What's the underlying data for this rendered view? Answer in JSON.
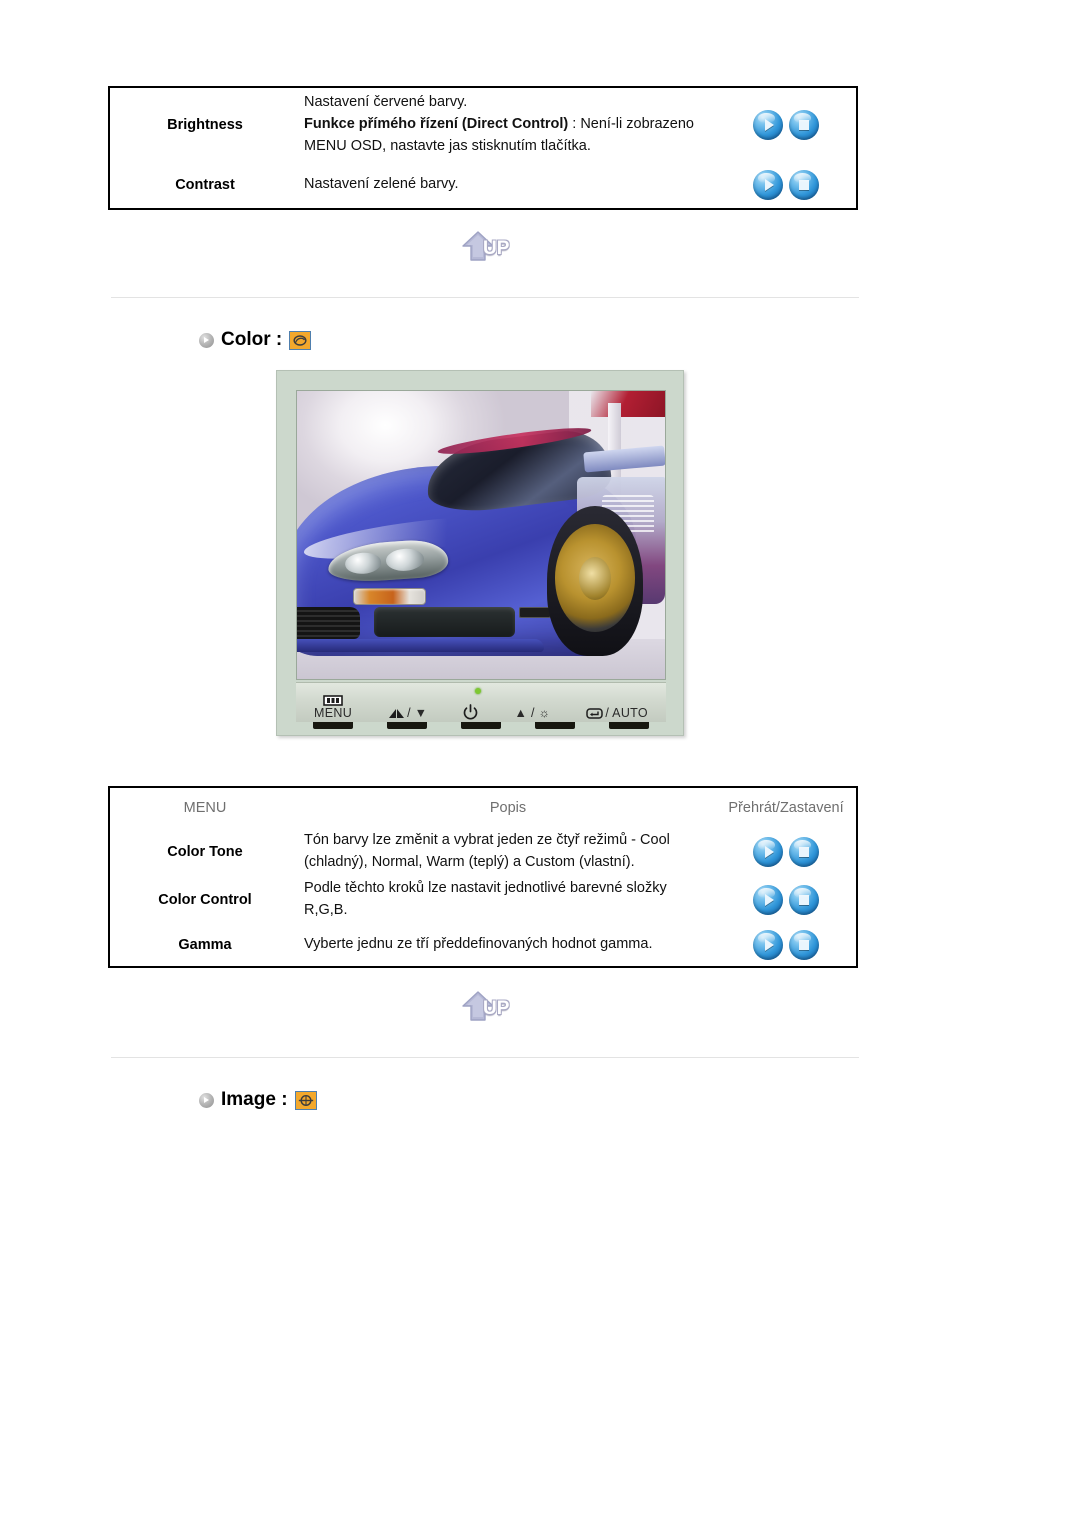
{
  "table1": {
    "rows": [
      {
        "menu": "Brightness",
        "desc_line1": "Nastavení červené barvy.",
        "desc_bold": "Funkce přímého řízení (Direct Control)",
        "desc_after_bold": " : Není-li zobrazeno MENU OSD, nastavte jas stisknutím tlačítka.",
        "play_label": "play-button",
        "stop_label": "stop-button"
      },
      {
        "menu": "Contrast",
        "desc_line1": "Nastavení zelené barvy.",
        "desc_bold": "",
        "desc_after_bold": "",
        "play_label": "play-button",
        "stop_label": "stop-button"
      }
    ]
  },
  "up_button": {
    "label": "UP",
    "icon": "up-arrow-icon"
  },
  "color_section": {
    "bullet_icon": "bullet-arrow-icon",
    "title": "Color :",
    "osd_icon": "color-osd-icon"
  },
  "monitor": {
    "screen_image": "blue-sports-car-photo",
    "power_led": "power-led-indicator",
    "buttons": [
      {
        "icon": "menu-icon",
        "label": "MENU"
      },
      {
        "icon": "source-down-icon",
        "label": "/ ▼"
      },
      {
        "icon": "power-icon",
        "label": "⏻"
      },
      {
        "icon": "up-brightness-icon",
        "label": "▲ / ☼"
      },
      {
        "icon": "enter-auto-icon",
        "label": "/ AUTO"
      }
    ]
  },
  "table2": {
    "headers": {
      "menu": "MENU",
      "desc": "Popis",
      "ctrl": "Přehrát/Zastavení"
    },
    "rows": [
      {
        "menu": "Color Tone",
        "desc": "Tón barvy lze změnit a vybrat jeden ze čtyř režimů - Cool (chladný), Normal, Warm (teplý) a Custom (vlastní).",
        "play_label": "play-button",
        "stop_label": "stop-button"
      },
      {
        "menu": "Color Control",
        "desc": "Podle těchto kroků lze nastavit jednotlivé barevné složky R,G,B.",
        "play_label": "play-button",
        "stop_label": "stop-button"
      },
      {
        "menu": "Gamma",
        "desc": "Vyberte jednu ze tří předdefinovaných hodnot gamma.",
        "play_label": "play-button",
        "stop_label": "stop-button"
      }
    ]
  },
  "up_button2": {
    "label": "UP",
    "icon": "up-arrow-icon"
  },
  "image_section": {
    "bullet_icon": "bullet-arrow-icon",
    "title": "Image :",
    "osd_icon": "image-osd-icon"
  },
  "colors": {
    "orb_blue": "#2f95d8",
    "osd_orange": "#f3a82c",
    "osd_border_blue": "#4f7fae",
    "header_gray": "#6f6f6f",
    "rule_gray": "#e3e3e3",
    "monitor_bezel": "#ccd8cc",
    "led_green": "#7ec832"
  }
}
